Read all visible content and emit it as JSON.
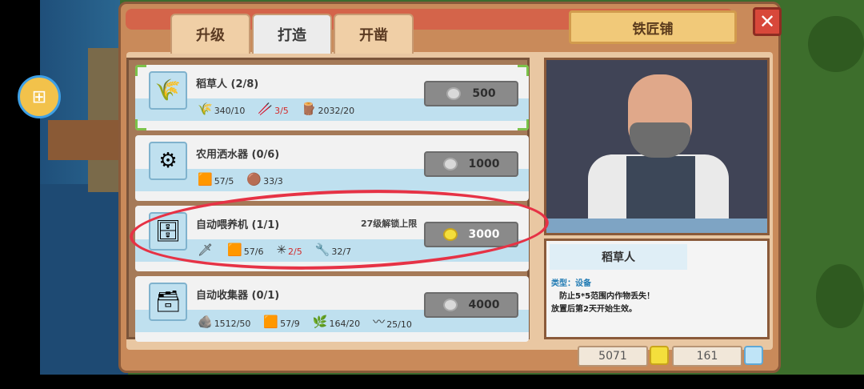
{
  "tabs": [
    {
      "label": "升级"
    },
    {
      "label": "打造"
    },
    {
      "label": "开凿"
    }
  ],
  "shop_title": "铁匠铺",
  "close_icon": "close-icon",
  "items": [
    {
      "name": "稻草人 (2/8)",
      "icon": "scarecrow-icon",
      "materials": [
        {
          "icon": "wheat-icon",
          "value": "340/10"
        },
        {
          "icon": "stick-icon",
          "value": "3/5",
          "insufficient": true
        },
        {
          "icon": "wood-icon",
          "value": "2032/20"
        }
      ],
      "price": "500",
      "coin": "silver"
    },
    {
      "name": "农用洒水器 (0/6)",
      "icon": "sprinkler-icon",
      "materials": [
        {
          "icon": "copper-icon",
          "value": "57/5"
        },
        {
          "icon": "ore-icon",
          "value": "33/3"
        }
      ],
      "price": "1000",
      "coin": "silver"
    },
    {
      "name": "自动喂养机 (1/1)",
      "icon": "feeder-icon",
      "unlock_text": "27级解锁上限",
      "materials": [
        {
          "icon": "tool-icon",
          "value": ""
        },
        {
          "icon": "copper-icon",
          "value": "57/6"
        },
        {
          "icon": "fiber-icon",
          "value": "2/5",
          "insufficient": true
        },
        {
          "icon": "wrench-icon",
          "value": "32/7"
        }
      ],
      "price": "3000",
      "coin": "gold"
    },
    {
      "name": "自动收集器 (0/1)",
      "icon": "collector-icon",
      "materials": [
        {
          "icon": "stone-icon",
          "value": "1512/50"
        },
        {
          "icon": "copper-icon",
          "value": "57/9"
        },
        {
          "icon": "vine-icon",
          "value": "164/20"
        },
        {
          "icon": "rope-icon",
          "value": "25/10"
        }
      ],
      "price": "4000",
      "coin": "silver"
    }
  ],
  "info": {
    "title": "稻草人",
    "type": "类型：设备",
    "desc1": "防止5*5范围内作物丢失！",
    "desc2": "放置后第2天开始生效。"
  },
  "currency": {
    "gold": "5071",
    "gems": "161"
  },
  "colors": {
    "annotation": "#e63245",
    "insufficient": "#d32a2a"
  }
}
